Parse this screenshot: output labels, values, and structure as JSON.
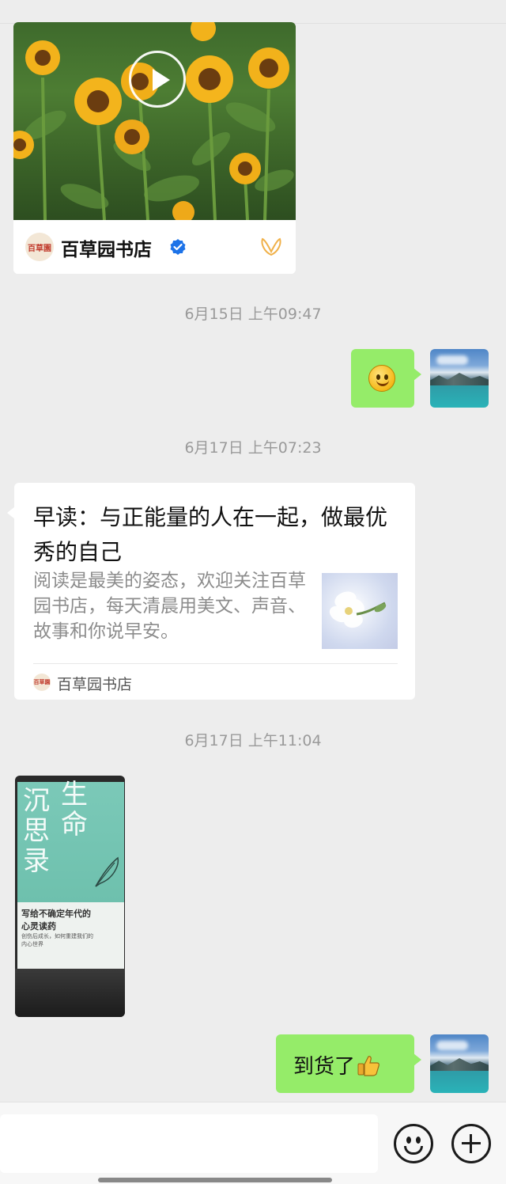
{
  "channel_card": {
    "name": "百草园书店",
    "logo_text": "百草園",
    "icons": [
      "play-icon",
      "verified-icon",
      "channels-butterfly-icon"
    ],
    "verified_color": "#1d73e8",
    "butterfly_color": "#f0b14a"
  },
  "timestamps": {
    "t1": "6月15日 上午09:47",
    "t2": "6月17日 上午07:23",
    "t3": "6月17日 上午11:04"
  },
  "article": {
    "title": "早读：与正能量的人在一起，做最优秀的自己",
    "description": "阅读是最美的姿态，欢迎关注百草园书店，每天清晨用美文、声音、故事和你说早安。",
    "source": "百草园书店",
    "logo_text": "百草園"
  },
  "book": {
    "title_col1": [
      "沉",
      "思",
      "录"
    ],
    "title_col2": [
      "生",
      "命"
    ],
    "subtitle": "写给不确定年代的",
    "subtitle2": "心灵读药",
    "tagline": "创伤后成长，如何重建我们的",
    "tagline2": "内心世界"
  },
  "messages": {
    "arrived_text": "到货了",
    "arrived_emoji": "thumbs-up-icon",
    "first_reply_emoji": "smile-icon"
  },
  "colors": {
    "background": "#ededed",
    "bubble_green": "#95ec69",
    "bubble_white": "#ffffff",
    "timestamp": "#9a9a9a"
  },
  "input_bar": {
    "placeholder": "",
    "icons": [
      "emoji-icon",
      "plus-icon"
    ]
  }
}
